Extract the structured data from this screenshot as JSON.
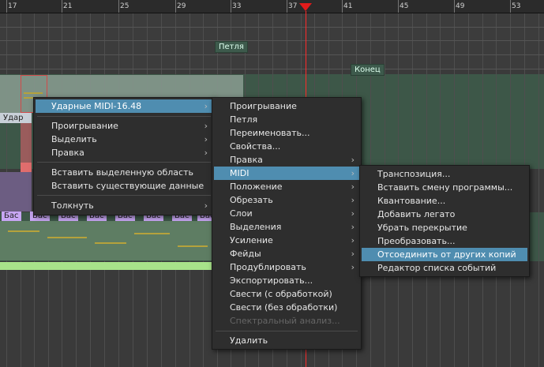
{
  "ruler": {
    "ticks": [
      "17",
      "21",
      "25",
      "29",
      "33",
      "37",
      "41",
      "45",
      "49",
      "53"
    ]
  },
  "markers": {
    "loop": "Петля",
    "end": "Конец"
  },
  "track": {
    "drum_label": "Удар",
    "bass_chips": [
      "Бас",
      "Бас",
      "Бас",
      "Бас",
      "Бас",
      "Бас",
      "Бас",
      "Бас"
    ]
  },
  "menu1": {
    "header": "Ударные MIDI-16.48",
    "items": [
      "Проигрывание",
      "Выделить",
      "Правка"
    ],
    "items2": [
      "Вставить выделенную область",
      "Вставить существующие данные"
    ],
    "items3": [
      "Толкнуть"
    ]
  },
  "menu2": {
    "items": [
      "Проигрывание",
      "Петля",
      "Переименовать...",
      "Свойства...",
      "Правка",
      "MIDI",
      "Положение",
      "Обрезать",
      "Слои",
      "Выделения",
      "Усиление",
      "Фейды",
      "Продублировать",
      "Экспортировать...",
      "Свести (с обработкой)",
      "Свести (без обработки)",
      "Спектральный анализ..."
    ],
    "delete": "Удалить"
  },
  "menu3": {
    "items": [
      "Транспозиция...",
      "Вставить смену программы...",
      "Квантование...",
      "Добавить легато",
      "Убрать перекрытие",
      "Преобразовать...",
      "Отсоединить от других копий",
      "Редактор списка событий"
    ]
  },
  "colors": {
    "highlight": "#4f8db0",
    "playhead": "#e21b1b",
    "region_green": "#5a7a62",
    "bass_chip": "#c7a6f3"
  }
}
